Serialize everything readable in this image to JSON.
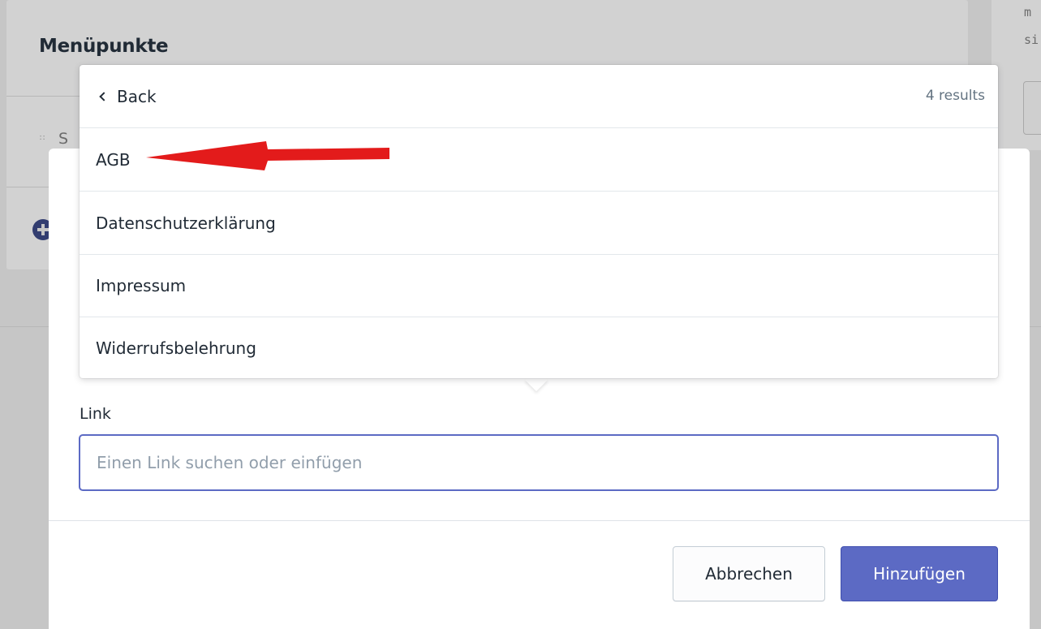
{
  "background": {
    "section_title": "Menüpunkte",
    "menu_item_text": "S",
    "code_line_1": "m",
    "code_line_2": "si"
  },
  "popover": {
    "back_label": "Back",
    "results_count": "4 results",
    "results": [
      {
        "label": "AGB"
      },
      {
        "label": "Datenschutzerklärung"
      },
      {
        "label": "Impressum"
      },
      {
        "label": "Widerrufsbelehrung"
      }
    ]
  },
  "form": {
    "link_label": "Link",
    "link_placeholder": "Einen Link suchen oder einfügen",
    "link_value": ""
  },
  "buttons": {
    "cancel_label": "Abbrechen",
    "add_label": "Hinzufügen"
  },
  "colors": {
    "accent": "#5c6ac4",
    "annotation_arrow": "#e31b1b"
  },
  "icons": {
    "back": "chevron-left-icon",
    "drag": "drag-handle-icon",
    "add": "plus-circle-icon"
  }
}
